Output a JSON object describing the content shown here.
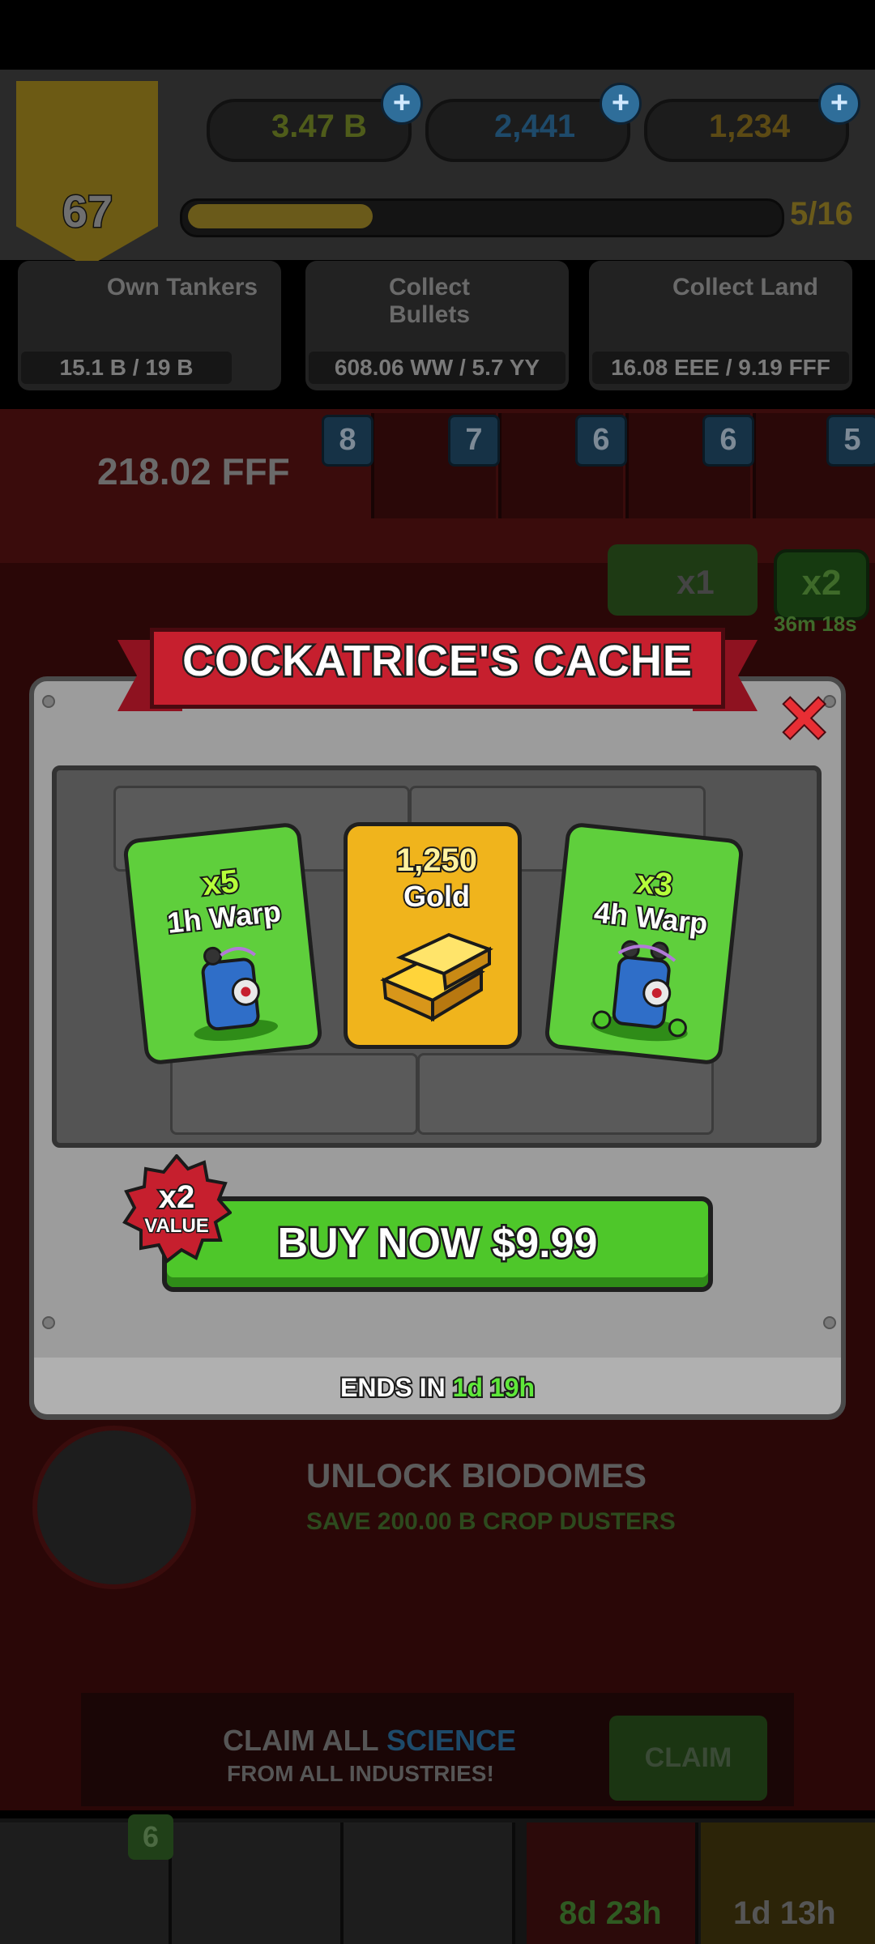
{
  "hud": {
    "level": "67",
    "cash": "3.47 B",
    "science": "2,441",
    "gold": "1,234",
    "xp_progress": "5/16",
    "xp_fraction": 0.3125
  },
  "tasks": [
    {
      "title": "Own Tankers",
      "progress": "15.1 B / 19 B",
      "fraction": 0.79
    },
    {
      "title": "Collect Bullets",
      "progress": "608.06 WW / 5.7 YY",
      "fraction": 0.1
    },
    {
      "title": "Collect Land",
      "progress": "16.08 EEE / 9.19 FFF",
      "fraction": 0.1
    }
  ],
  "industry": {
    "total": "218.02 FFF",
    "badges": [
      "8",
      "7",
      "6",
      "6",
      "5"
    ]
  },
  "multiplier": {
    "current": "x1",
    "boost": "x2",
    "boost_timer": "36m 18s"
  },
  "biodome": {
    "title": "UNLOCK BIODOMES",
    "subtitle": "SAVE 200.00 B CROP DUSTERS"
  },
  "claim": {
    "line1_a": "CLAIM ALL ",
    "line1_b": "SCIENCE",
    "line2": "FROM ALL INDUSTRIES!",
    "button": "CLAIM"
  },
  "bottom_nav": {
    "badge": "6",
    "timer1": "8d 23h",
    "timer2": "1d 13h"
  },
  "offer": {
    "title": "COCKATRICE'S CACHE",
    "cards": [
      {
        "qty": "x5",
        "label": "1h Warp",
        "type": "warp"
      },
      {
        "qty": "1,250",
        "label": "Gold",
        "type": "gold"
      },
      {
        "qty": "x3",
        "label": "4h Warp",
        "type": "warp"
      }
    ],
    "value_badge_mult": "x2",
    "value_badge_word": "VALUE",
    "buy_label": "BUY NOW $9.99",
    "ends_prefix": "ENDS IN ",
    "ends_timer": "1d 19h"
  },
  "colors": {
    "accent_green": "#4ec72a",
    "banner_red": "#c61f2e",
    "gold_card": "#f0b41c"
  }
}
